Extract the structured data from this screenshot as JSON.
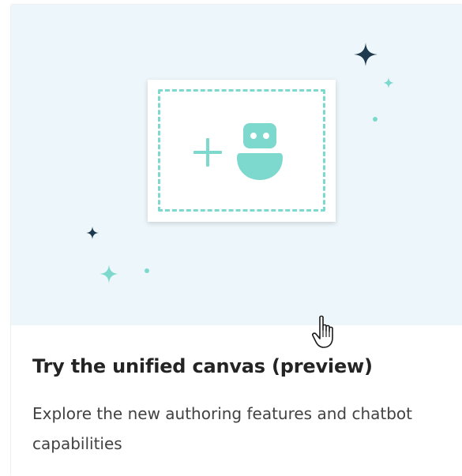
{
  "card": {
    "title": "Try the unified canvas (preview)",
    "description": "Explore the new authoring features and chatbot capabilities"
  },
  "illustration": {
    "icons": [
      "plus-icon",
      "bot-icon",
      "sparkle-icon"
    ],
    "colors": {
      "background": "#edf7fb",
      "accent": "#7dd8cd",
      "dark_sparkle": "#1f3a4d"
    }
  },
  "cursor": {
    "icon": "hand-pointer-icon"
  }
}
